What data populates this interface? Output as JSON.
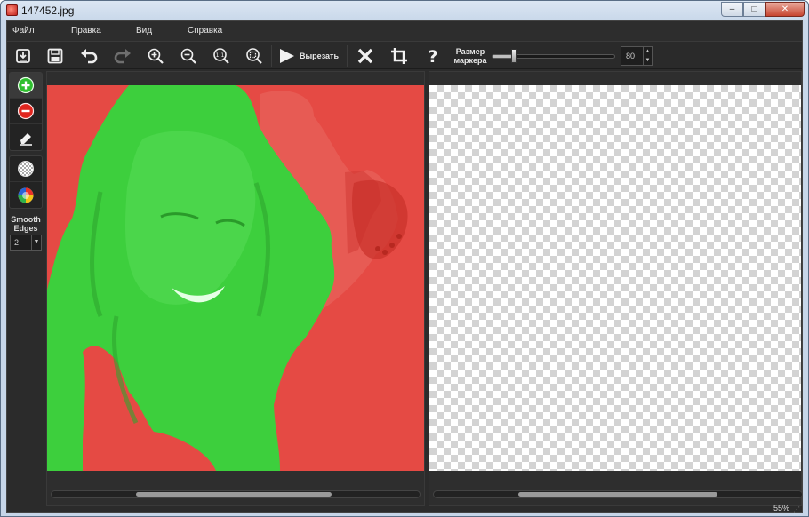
{
  "window": {
    "title": "147452.jpg",
    "minimize": "–",
    "maximize": "□",
    "close": "✕"
  },
  "menu": [
    "Файл",
    "Правка",
    "Вид",
    "Справка"
  ],
  "toolbar": {
    "buttons": [
      "open-icon",
      "save-icon",
      "undo-icon",
      "redo-icon",
      "zoom-in-icon",
      "zoom-out-icon",
      "zoom-actual-icon",
      "zoom-fit-icon"
    ],
    "cut_label": "Вырезать",
    "marker_label": "Размер маркера",
    "marker_value": "80",
    "marker_fraction": 0.16
  },
  "side": {
    "smooth_label": "Smooth Edges",
    "smooth_value": "2"
  },
  "scroll": {
    "left_thumb": [
      0.23,
      0.76
    ],
    "right_thumb": [
      0.23,
      0.77
    ]
  },
  "status": {
    "zoom": "55%"
  },
  "colors": {
    "keep": "#3fd23f",
    "remove": "#e9504a",
    "background": "#2b2b2b"
  }
}
